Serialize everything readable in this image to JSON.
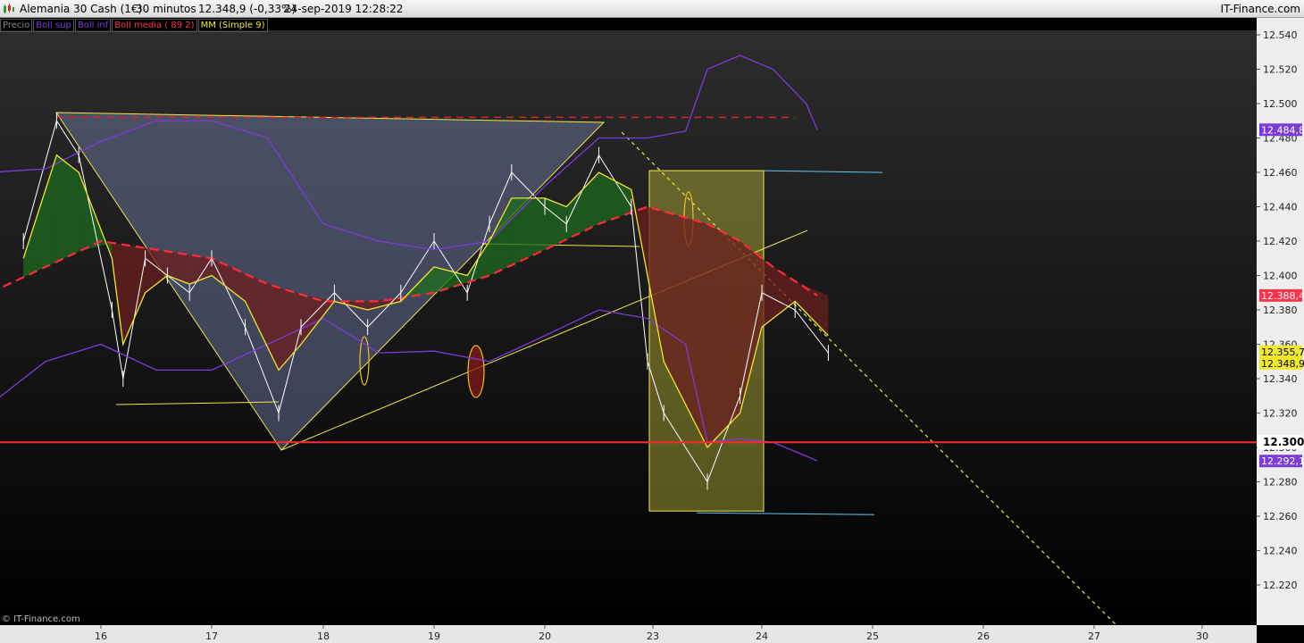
{
  "header": {
    "instrument": "Alemania 30 Cash (1€)",
    "timeframe": "30 minutos",
    "quote": "12.348,9 (-0,33%)",
    "datetime": "24-sep-2019 12:28:22",
    "brand": "IT-Finance.com"
  },
  "legend": [
    {
      "label": "Precio",
      "color": "#8a8a8a"
    },
    {
      "label": "Boll sup",
      "color": "#7b3cd9"
    },
    {
      "label": "Boll inf",
      "color": "#7b3cd9"
    },
    {
      "label": "Boll media ( 89 2)",
      "color": "#ff3347"
    },
    {
      "label": "MM (Simple 9)",
      "color": "#f2e82a"
    }
  ],
  "footer": "© IT-Finance.com",
  "chart_data": {
    "type": "line",
    "x_ticks": [
      "16",
      "17",
      "18",
      "19",
      "20",
      "23",
      "24",
      "25",
      "26",
      "27",
      "30"
    ],
    "y_ticks": [
      "12.220",
      "12.240",
      "12.260",
      "12.280",
      "12.300",
      "12.320",
      "12.340",
      "12.360",
      "12.380",
      "12.400",
      "12.420",
      "12.440",
      "12.460",
      "12.480",
      "12.500",
      "12.520",
      "12.540"
    ],
    "ylim": [
      12200,
      12550
    ],
    "horizontal_line": {
      "value": 12303,
      "label": "12.300",
      "color": "#ff2a2a"
    },
    "price_labels": [
      {
        "text": "12.484,8",
        "value": 12484.8,
        "color": "#7b3cd9"
      },
      {
        "text": "12.388,4",
        "value": 12388.4,
        "color": "#ff3347"
      },
      {
        "text": "12.355,7",
        "value": 12355.7,
        "color": "#f2e82a"
      },
      {
        "text": "12.348,9",
        "value": 12348.9,
        "color": "#f2e82a"
      },
      {
        "text": "12.292,1",
        "value": 12292.1,
        "color": "#7b3cd9"
      }
    ],
    "series": [
      {
        "name": "Precio",
        "x": [
          15.3,
          15.6,
          15.8,
          16.1,
          16.2,
          16.4,
          16.6,
          16.8,
          17.0,
          17.3,
          17.6,
          17.8,
          18.1,
          18.4,
          18.7,
          19.0,
          19.3,
          19.5,
          19.7,
          20.0,
          20.2,
          20.5,
          20.8,
          20.95,
          21.1,
          21.5,
          21.8,
          22.0,
          22.3,
          22.6
        ],
        "values": [
          12420,
          12490,
          12470,
          12380,
          12340,
          12410,
          12400,
          12390,
          12410,
          12370,
          12320,
          12370,
          12390,
          12370,
          12390,
          12420,
          12390,
          12430,
          12460,
          12440,
          12430,
          12470,
          12440,
          12350,
          12320,
          12280,
          12330,
          12390,
          12380,
          12355
        ]
      },
      {
        "name": "Boll sup",
        "x": [
          15.0,
          15.5,
          16.0,
          16.5,
          17.0,
          17.5,
          18.0,
          18.5,
          19.0,
          19.5,
          20.0,
          20.5,
          20.95,
          21.3,
          21.5,
          21.8,
          22.1,
          22.4,
          22.5
        ],
        "values": [
          12460,
          12462,
          12478,
          12490,
          12490,
          12480,
          12430,
          12420,
          12415,
          12420,
          12452,
          12480,
          12480,
          12484,
          12520,
          12528,
          12520,
          12500,
          12484.8
        ]
      },
      {
        "name": "Boll inf",
        "x": [
          15.0,
          15.5,
          16.0,
          16.5,
          17.0,
          17.5,
          18.0,
          18.5,
          19.0,
          19.5,
          20.0,
          20.5,
          20.95,
          21.3,
          21.5,
          21.8,
          22.1,
          22.4,
          22.5
        ],
        "values": [
          12325,
          12350,
          12360,
          12345,
          12345,
          12360,
          12375,
          12355,
          12356,
          12350,
          12365,
          12380,
          12375,
          12360,
          12303,
          12305,
          12303,
          12295,
          12292.1
        ]
      },
      {
        "name": "Boll media ( 89 2)",
        "x": [
          15.0,
          15.5,
          16.0,
          16.5,
          17.0,
          17.5,
          18.0,
          18.5,
          19.0,
          19.5,
          20.0,
          20.5,
          20.95,
          21.5,
          21.8,
          22.1,
          22.5
        ],
        "values": [
          12390,
          12405,
          12420,
          12415,
          12410,
          12395,
          12385,
          12385,
          12390,
          12400,
          12415,
          12430,
          12440,
          12430,
          12420,
          12405,
          12388.4
        ]
      },
      {
        "name": "MM (Simple 9)",
        "x": [
          15.3,
          15.6,
          15.8,
          16.1,
          16.2,
          16.4,
          16.6,
          16.8,
          17.0,
          17.3,
          17.6,
          17.8,
          18.1,
          18.4,
          18.7,
          19.0,
          19.3,
          19.5,
          19.7,
          20.0,
          20.2,
          20.5,
          20.8,
          20.95,
          21.1,
          21.5,
          21.8,
          22.0,
          22.3,
          22.6
        ],
        "values": [
          12410,
          12470,
          12460,
          12410,
          12360,
          12390,
          12400,
          12395,
          12400,
          12385,
          12345,
          12360,
          12385,
          12380,
          12385,
          12405,
          12400,
          12420,
          12445,
          12445,
          12440,
          12460,
          12450,
          12400,
          12350,
          12300,
          12320,
          12370,
          12385,
          12365
        ]
      }
    ],
    "drawings": {
      "upper_dashed_line": 12492,
      "rectangle_top": 12461,
      "rectangle_bottom": 12263
    }
  }
}
